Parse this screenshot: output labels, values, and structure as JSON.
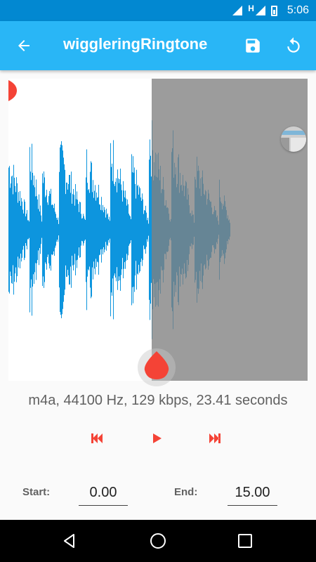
{
  "status_bar": {
    "time": "5:06",
    "network_letter": "H",
    "icons": [
      "wifi-signal-icon",
      "cell-signal-icon",
      "battery-icon"
    ]
  },
  "app_bar": {
    "title": "wiggleringRingtone",
    "icons": [
      "back-arrow-icon",
      "save-icon",
      "reset-icon"
    ]
  },
  "colors": {
    "status_bar": "#0288d1",
    "app_bar": "#29b6f6",
    "waveform": "#0d95de",
    "marker": "#f44336",
    "selection_shade": "#8f8f8f"
  },
  "info": {
    "text": "m4a, 44100 Hz, 129 kbps, 23.41 seconds"
  },
  "playback": {
    "icons": [
      "skip-previous-icon",
      "play-icon",
      "skip-next-icon"
    ]
  },
  "selection": {
    "start_label": "Start:",
    "start_value": "0.00",
    "end_label": "End:",
    "end_value": "15.00"
  },
  "nav_bar": {
    "icons": [
      "back-triangle-icon",
      "home-circle-icon",
      "recents-square-icon"
    ]
  }
}
